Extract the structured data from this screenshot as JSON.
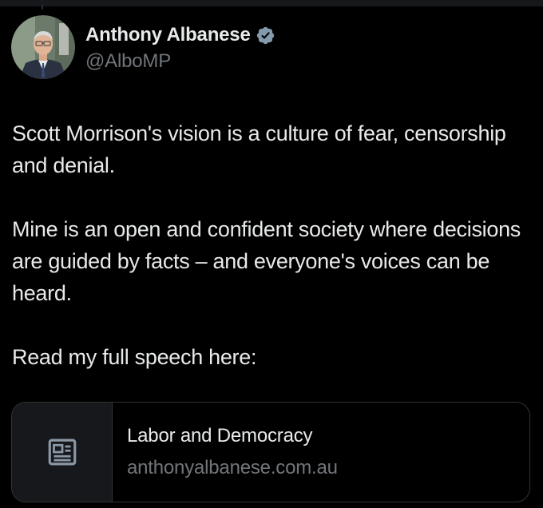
{
  "author": {
    "display_name": "Anthony Albanese",
    "handle": "@AlboMP",
    "avatar_icon": "profile-photo",
    "verified_icon": "verified-badge-icon",
    "verified_color": "#829aab"
  },
  "tweet": {
    "paragraphs": [
      "Scott Morrison's vision is a culture of fear, censorship and denial.",
      "Mine is an open and confident society where decisions are guided by facts – and everyone's voices can be heard.",
      "Read my full speech here:"
    ]
  },
  "link_card": {
    "icon": "article-icon",
    "title": "Labor and Democracy",
    "domain": "anthonyalbanese.com.au"
  },
  "colors": {
    "background": "#000000",
    "text_primary": "#e7e9ea",
    "text_secondary": "#71767b",
    "border": "#2f3336"
  }
}
